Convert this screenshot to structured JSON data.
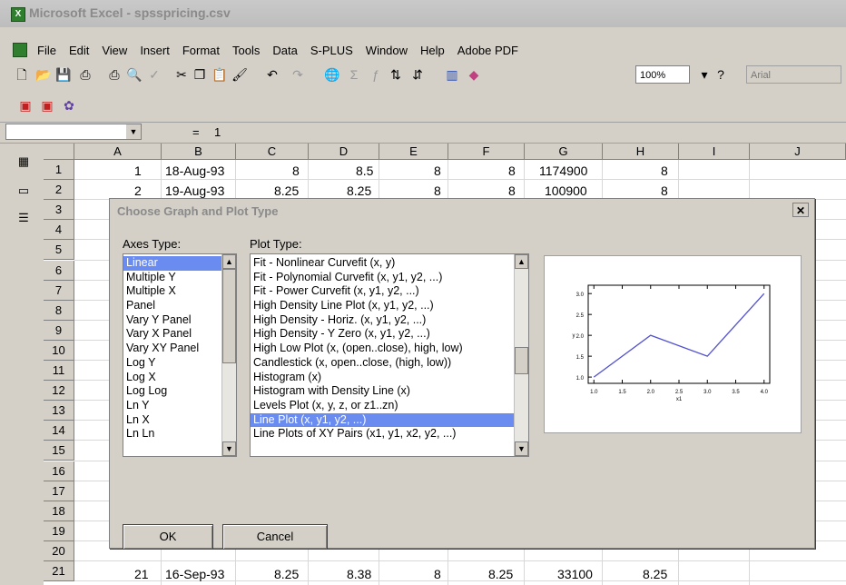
{
  "window": {
    "title": "Microsoft Excel - spsspricing.csv"
  },
  "menu": [
    "File",
    "Edit",
    "View",
    "Insert",
    "Format",
    "Tools",
    "Data",
    "S-PLUS",
    "Window",
    "Help",
    "Adobe PDF"
  ],
  "toolbar": {
    "zoom": "100%",
    "font": "Arial"
  },
  "formula_bar": {
    "name_box": "",
    "equals": "=",
    "value": "1"
  },
  "sheet": {
    "columns": [
      "A",
      "B",
      "C",
      "D",
      "E",
      "F",
      "G",
      "H",
      "I",
      "J"
    ],
    "rows": [
      "1",
      "2",
      "3",
      "4",
      "5",
      "6",
      "7",
      "8",
      "9",
      "10",
      "11",
      "12",
      "13",
      "14",
      "15",
      "16",
      "17",
      "18",
      "19",
      "20",
      "21"
    ],
    "row1": [
      "1",
      "18-Aug-93",
      "8",
      "8.5",
      "8",
      "8",
      "1174900",
      "8"
    ],
    "row2": [
      "2",
      "19-Aug-93",
      "8.25",
      "8.25",
      "8",
      "8",
      "100900",
      "8"
    ],
    "row21": [
      "21",
      "16-Sep-93",
      "8.25",
      "8.38",
      "8",
      "8.25",
      "33100",
      "8.25"
    ]
  },
  "dialog": {
    "title": "Choose Graph and Plot Type",
    "axes_label": "Axes Type:",
    "plot_label": "Plot Type:",
    "axes_types": [
      "Linear",
      "Multiple Y",
      "Multiple X",
      "Panel",
      "Vary Y Panel",
      "Vary X Panel",
      "Vary XY Panel",
      "Log Y",
      "Log X",
      "Log Log",
      "Ln Y",
      "Ln X",
      "Ln Ln"
    ],
    "axes_selected": "Linear",
    "plot_types": [
      "Fit - Nonlinear Curvefit (x, y)",
      "Fit - Polynomial Curvefit (x, y1, y2, ...)",
      "Fit - Power Curvefit (x, y1, y2, ...)",
      "High Density Line Plot (x, y1, y2, ...)",
      "High Density - Horiz. (x, y1, y2, ...)",
      "High Density - Y Zero (x, y1, y2, ...)",
      "High Low Plot (x, (open..close), high, low)",
      "Candlestick (x, open..close, (high, low))",
      "Histogram (x)",
      "Histogram with Density Line (x)",
      "Levels Plot (x, y, z, or z1..zn)",
      "Line Plot (x, y1, y2, ...)",
      "Line Plots of XY Pairs (x1, y1, x2, y2, ...)"
    ],
    "plot_selected": "Line Plot (x, y1, y2, ...)",
    "ok_label": "OK",
    "cancel_label": "Cancel",
    "preview": {
      "y_ticks": [
        "3.0",
        "2.5",
        "2.0",
        "1.5",
        "1.0"
      ],
      "x_ticks": [
        "1.0",
        "1.5",
        "2.0",
        "2.5",
        "3.0",
        "3.5",
        "4.0"
      ],
      "ylabel": "y",
      "xlabel": "x1",
      "points_x": [
        1.0,
        2.0,
        3.0,
        4.0
      ],
      "points_y": [
        1.0,
        2.0,
        1.5,
        3.0
      ]
    }
  }
}
